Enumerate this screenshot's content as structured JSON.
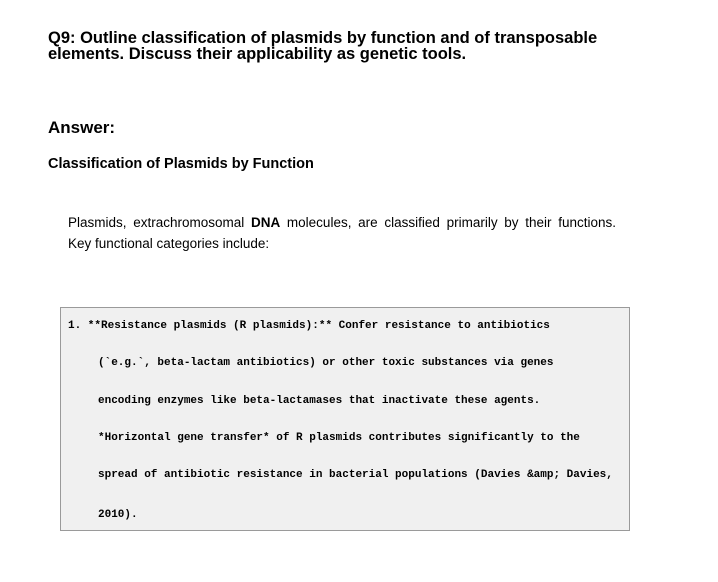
{
  "question": {
    "line1": "Q9: Outline classification of plasmids by function and of transposable",
    "line2": "elements. Discuss their applicability as genetic tools."
  },
  "answer_heading": "Answer:",
  "section_heading": "Classification of Plasmids by Function",
  "paragraph": {
    "before_bold": "Plasmids, extrachromosomal ",
    "bold": "DNA",
    "after_bold": " molecules, are classified primarily by their functions. Key functional categories include:"
  },
  "code_lines": [
    "1. **Resistance plasmids (R plasmids):** Confer resistance to antibiotics",
    "(`e.g.`, beta-lactam antibiotics) or other toxic substances via genes",
    "encoding enzymes like beta-lactamases that inactivate these agents.",
    "*Horizontal gene transfer* of R plasmids contributes significantly to the",
    "spread of antibiotic resistance in bacterial populations (Davies &amp; Davies,",
    "2010)."
  ]
}
